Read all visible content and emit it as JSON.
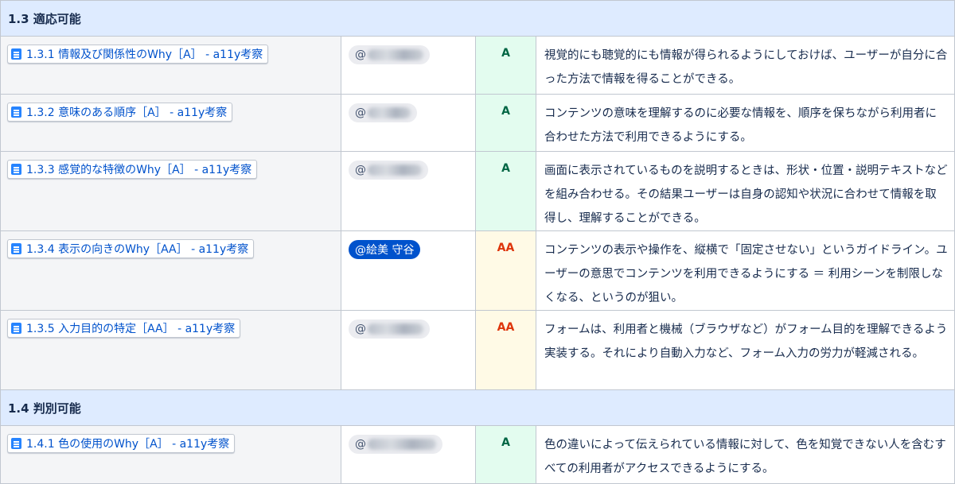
{
  "sections": [
    {
      "heading": "1.3 適応可能",
      "rows": [
        {
          "title": "1.3.1 情報及び関係性のWhy［A］ - a11y考察",
          "mention": "@",
          "self": false,
          "level": "A",
          "level_class": "a",
          "description": "視覚的にも聴覚的にも情報が得られるようにしておけば、ユーザーが自分に合った方法で情報を得ることができる。"
        },
        {
          "title": "1.3.2 意味のある順序［A］ - a11y考察",
          "mention": "@",
          "self": false,
          "level": "A",
          "level_class": "a",
          "description": "コンテンツの意味を理解するのに必要な情報を、順序を保ちながら利用者に合わせた方法で利用できるようにする。"
        },
        {
          "title": "1.3.3 感覚的な特徴のWhy［A］ - a11y考察",
          "mention": "@",
          "self": false,
          "level": "A",
          "level_class": "a",
          "description": "画面に表示されているものを説明するときは、形状・位置・説明テキストなどを組み合わせる。その結果ユーザーは自身の認知や状況に合わせて情報を取得し、理解することができる。"
        },
        {
          "title": "1.3.4 表示の向きのWhy［AA］ - a11y考察",
          "mention": "@絵美 守谷",
          "self": true,
          "level": "AA",
          "level_class": "aa",
          "description": "コンテンツの表示や操作を、縦横で「固定させない」というガイドライン。ユーザーの意思でコンテンツを利用できるようにする ＝ 利用シーンを制限しなくなる、というのが狙い。"
        },
        {
          "title": "1.3.5 入力目的の特定［AA］ - a11y考察",
          "mention": "@",
          "self": false,
          "level": "AA",
          "level_class": "aa",
          "description": "フォームは、利用者と機械（ブラウザなど）がフォーム目的を理解できるよう実装する。それにより自動入力など、フォーム入力の労力が軽減される。"
        }
      ]
    },
    {
      "heading": "1.4 判別可能",
      "rows": [
        {
          "title": "1.4.1 色の使用のWhy［A］ - a11y考察",
          "mention": "@",
          "self": false,
          "level": "A",
          "level_class": "a",
          "description": "色の違いによって伝えられている情報に対して、色を知覚できない人を含むすべての利用者がアクセスできるようにする。"
        }
      ]
    }
  ],
  "colors": {
    "section_bg": "#deebff",
    "title_cell_bg": "#f4f5f7",
    "level_a_bg": "#e3fcef",
    "level_a_text": "#006644",
    "level_aa_bg": "#fffae6",
    "level_aa_text": "#de350b",
    "link": "#0052cc",
    "self_mention_bg": "#0052cc"
  },
  "icons": {
    "page_link": "page-icon"
  }
}
